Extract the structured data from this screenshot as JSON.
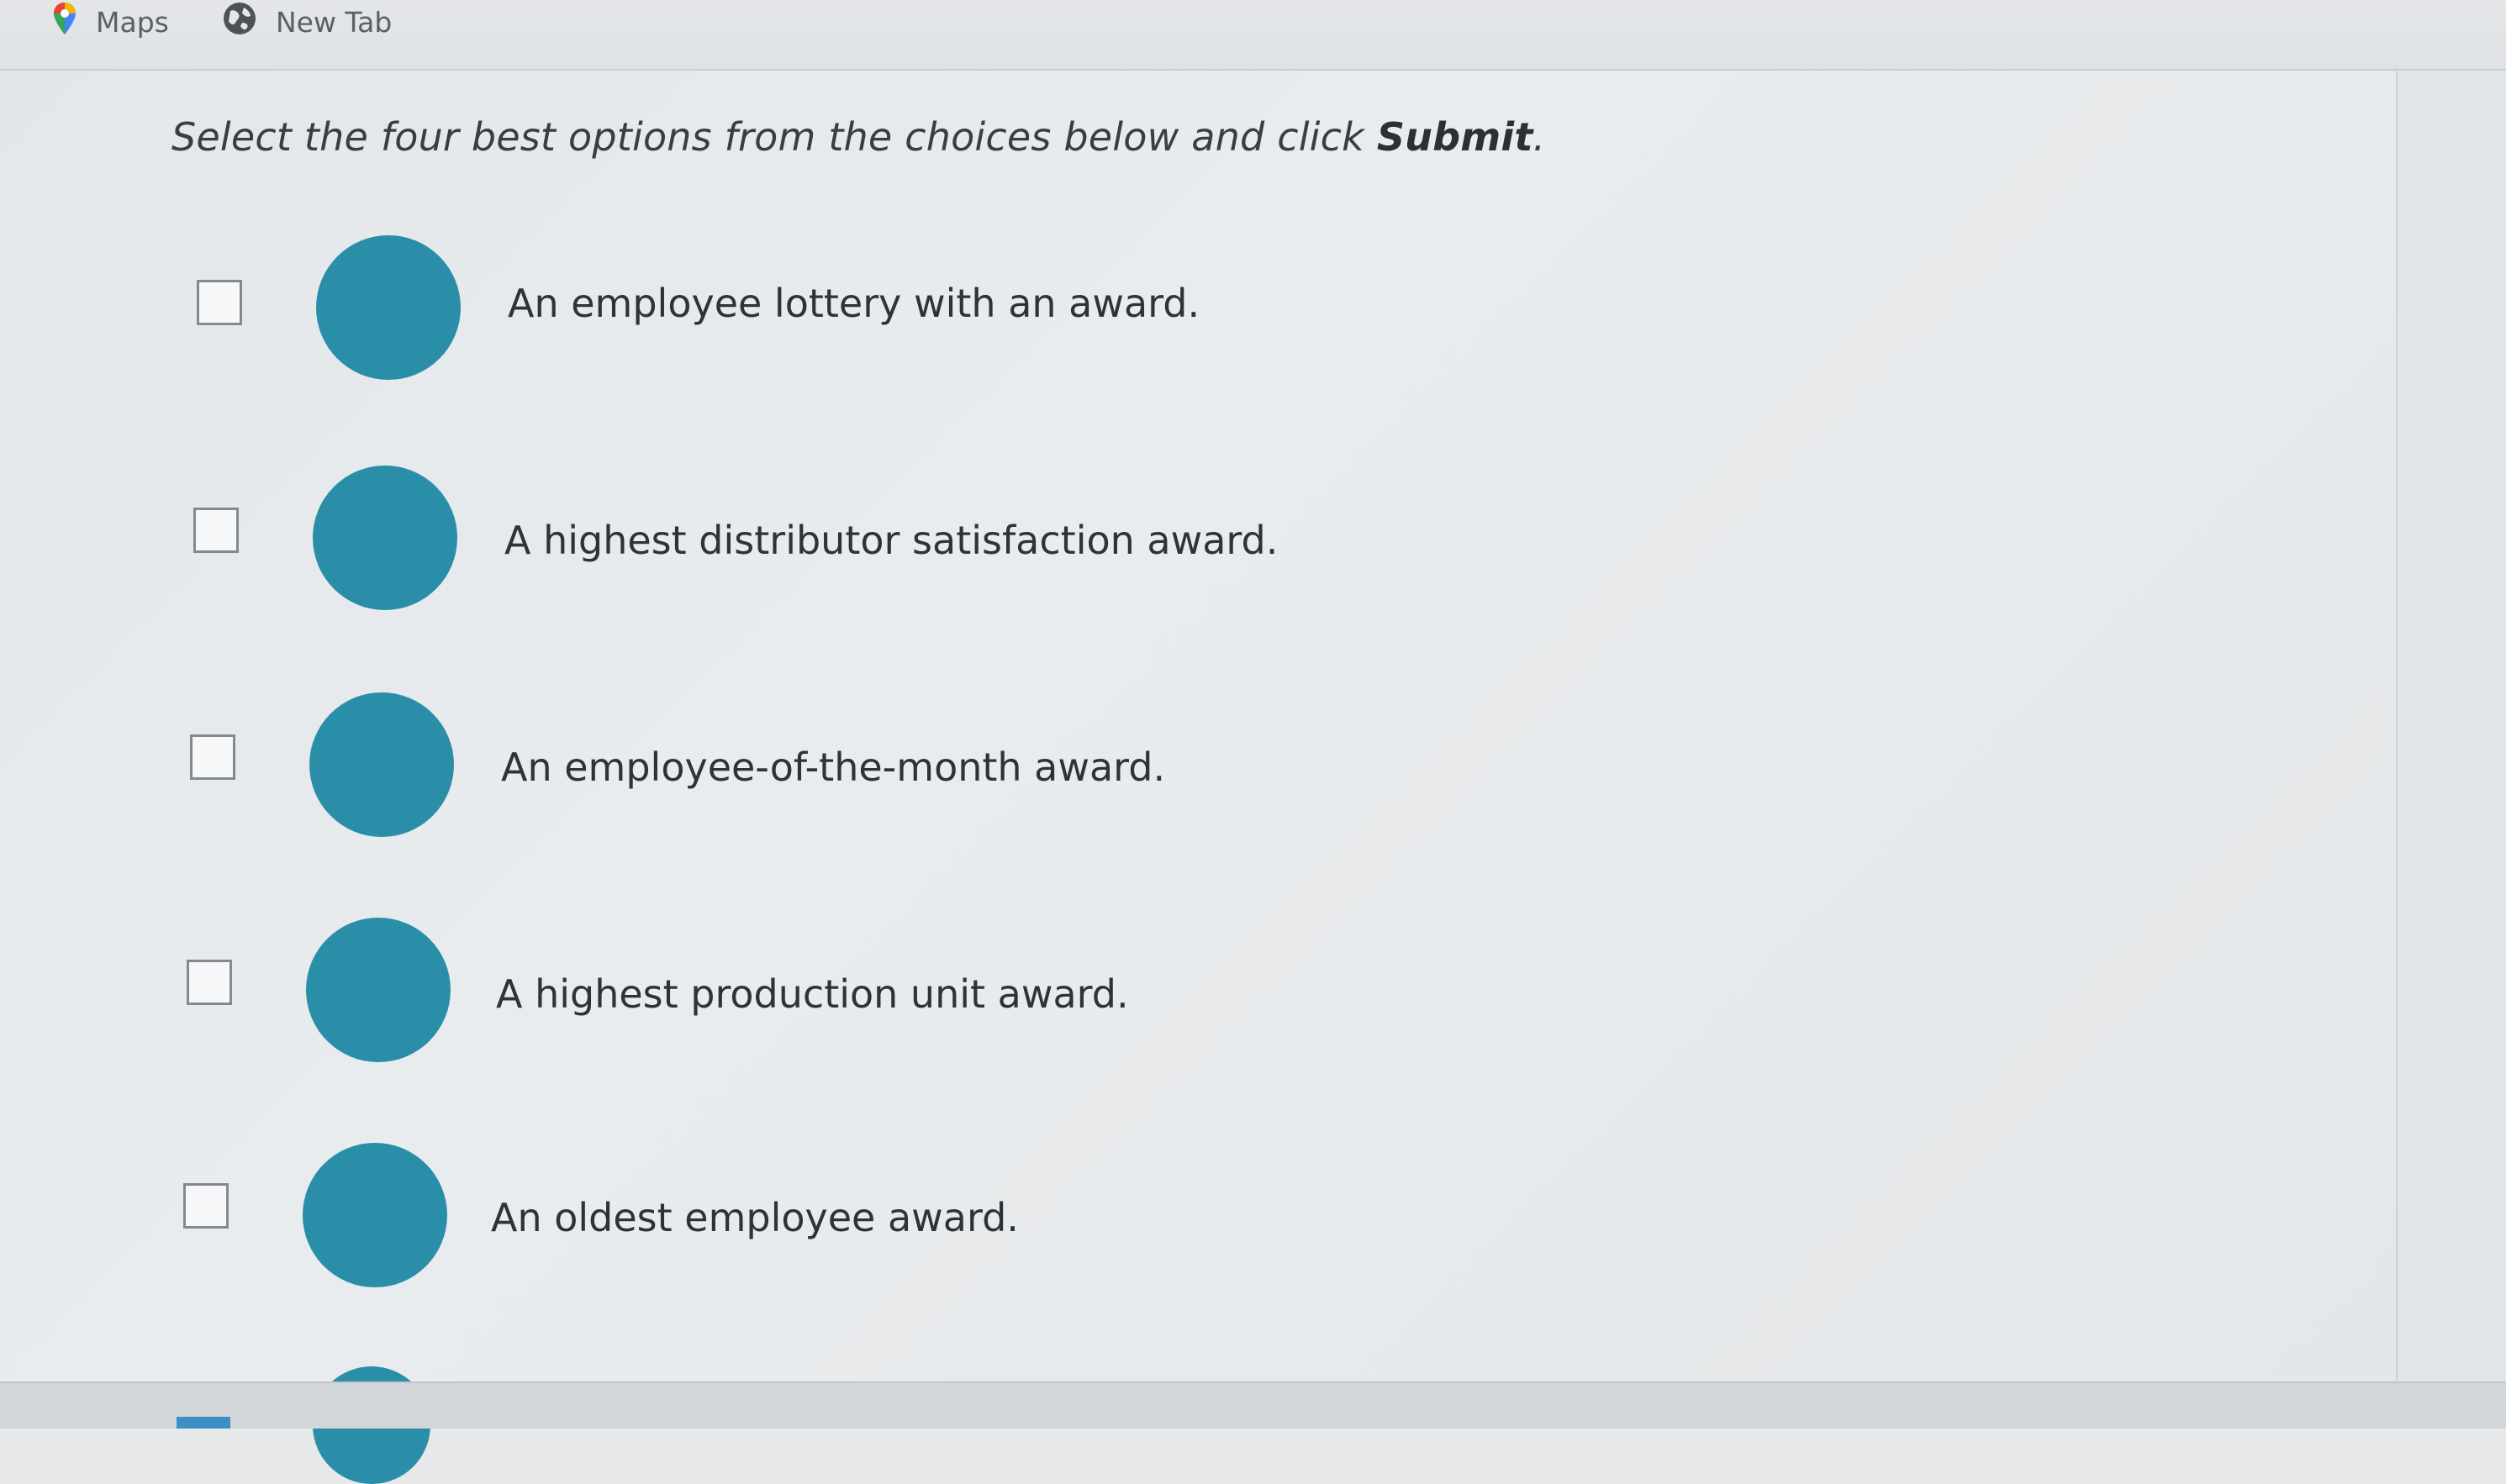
{
  "bookmarks": {
    "maps_label": "Maps",
    "newtab_label": "New Tab"
  },
  "question": {
    "instruction_text": "Select the four best options from the choices below and click ",
    "instruction_bold": "Submit",
    "instruction_end": "."
  },
  "options": [
    {
      "label": "An employee lottery with an award.",
      "checked": false
    },
    {
      "label": "A highest distributor satisfaction award.",
      "checked": false
    },
    {
      "label": "An employee-of-the-month award.",
      "checked": false
    },
    {
      "label": "A highest production unit award.",
      "checked": false
    },
    {
      "label": "An oldest employee award.",
      "checked": false
    }
  ],
  "colors": {
    "accent_circle": "#2b8ea9",
    "maps_pin_yellow": "#f4b400",
    "maps_pin_green": "#34a853",
    "maps_pin_blue": "#4285f4",
    "maps_pin_red": "#ea4335"
  },
  "icons": {
    "maps": "maps-pin-icon",
    "newtab": "globe-icon"
  }
}
